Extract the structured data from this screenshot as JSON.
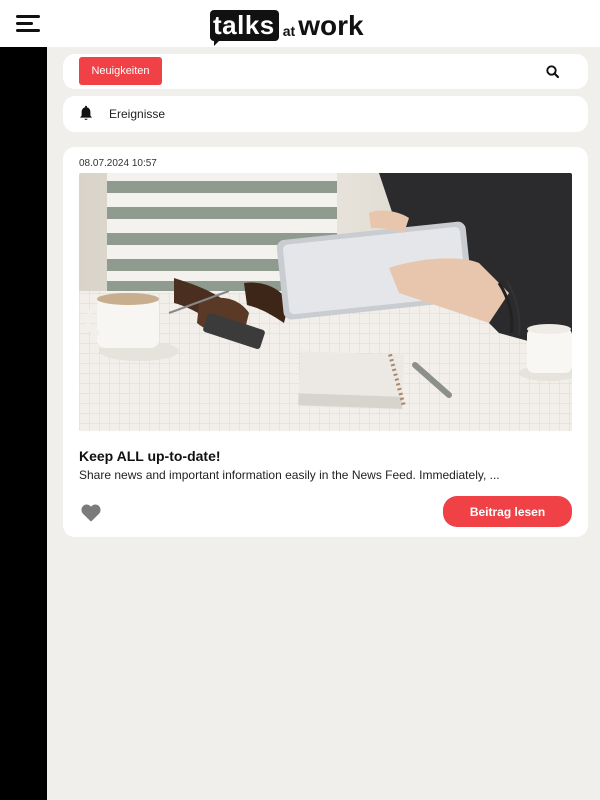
{
  "header": {
    "logo": {
      "talks": "talks",
      "at": "at",
      "work": "work"
    }
  },
  "tabs": {
    "active_label": "Neuigkeiten"
  },
  "events": {
    "label": "Ereignisse"
  },
  "post": {
    "date": "08.07.2024 10:57",
    "title": "Keep ALL up-to-date!",
    "excerpt": "Share news and important information easily in the News Feed. Immediately, ...",
    "read_label": "Beitrag lesen"
  },
  "icons": {
    "menu": "hamburger-menu-icon",
    "search": "search-icon",
    "bell": "bell-icon",
    "like": "heart-icon"
  },
  "colors": {
    "accent": "#ef4146",
    "background": "#f0efeb",
    "sidebar": "#000000"
  }
}
